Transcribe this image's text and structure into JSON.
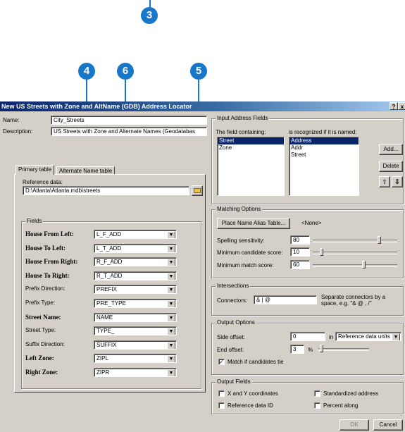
{
  "callouts": {
    "c3": "3",
    "c4": "4",
    "c5": "5",
    "c6": "6"
  },
  "dialog": {
    "title": "New US Streets with Zone and AltName (GDB) Address Locator",
    "help_btn": "?",
    "close_btn": "x",
    "name_label": "Name:",
    "name_value": "City_Streets",
    "description_label": "Description:",
    "description_value": "US Streets with Zone and Alternate Names (Geodatabas",
    "tabs": [
      "Primary table",
      "Alternate Name table"
    ],
    "reference_data_label": "Reference data:",
    "reference_data_value": "D:\\Atlanta\\Atlanta.mdb\\streets",
    "fields_group": "Fields",
    "fields": [
      {
        "label": "House From Left:",
        "value": "L_F_ADD",
        "bold": true
      },
      {
        "label": "House To Left:",
        "value": "L_T_ADD",
        "bold": true
      },
      {
        "label": "House From Right:",
        "value": "R_F_ADD",
        "bold": true
      },
      {
        "label": "House To Right:",
        "value": "R_T_ADD",
        "bold": true
      },
      {
        "label": "Prefix Direction:",
        "value": "PREFIX",
        "bold": false
      },
      {
        "label": "Prefix Type:",
        "value": "PRE_TYPE",
        "bold": false
      },
      {
        "label": "Street Name:",
        "value": "NAME",
        "bold": true
      },
      {
        "label": "Street Type:",
        "value": "TYPE_",
        "bold": false
      },
      {
        "label": "Suffix Direction:",
        "value": "SUFFIX",
        "bold": false
      },
      {
        "label": "Left Zone:",
        "value": "ZIPL",
        "bold": true
      },
      {
        "label": "Right Zone:",
        "value": "ZIPR",
        "bold": true
      }
    ],
    "input_address": {
      "group": "Input Address Fields",
      "field_containing_label": "The field containing:",
      "recognized_label": "is recognized if it is named:",
      "containing_items": [
        "Street",
        "Zone"
      ],
      "named_items": [
        "Address",
        "Addr",
        "Street"
      ],
      "add_btn": "Add...",
      "delete_btn": "Delete"
    },
    "matching": {
      "group": "Matching Options",
      "alias_btn": "Place Name Alias Table...",
      "alias_value": "<None>",
      "spelling_label": "Spelling sensitivity:",
      "spelling_value": "80",
      "min_candidate_label": "Minimum candidate score:",
      "min_candidate_value": "10",
      "min_match_label": "Minimum match score:",
      "min_match_value": "60"
    },
    "intersections": {
      "group": "Intersections",
      "connectors_label": "Connectors:",
      "connectors_value": "& | @",
      "note": "Separate connectors by a space, e.g. \"& @ , /\""
    },
    "output_options": {
      "group": "Output Options",
      "side_offset_label": "Side offset:",
      "side_offset_value": "0",
      "in_label": "in",
      "units_value": "Reference data units",
      "end_offset_label": "End offset:",
      "end_offset_value": "3",
      "percent": "%",
      "match_tie_label": "Match if candidates tie"
    },
    "output_fields": {
      "group": "Output Fields",
      "xy": "X and Y coordinates",
      "standardized": "Standardized address",
      "ref_id": "Reference data ID",
      "percent_along": "Percent along"
    },
    "ok_btn": "OK",
    "cancel_btn": "Cancel"
  }
}
